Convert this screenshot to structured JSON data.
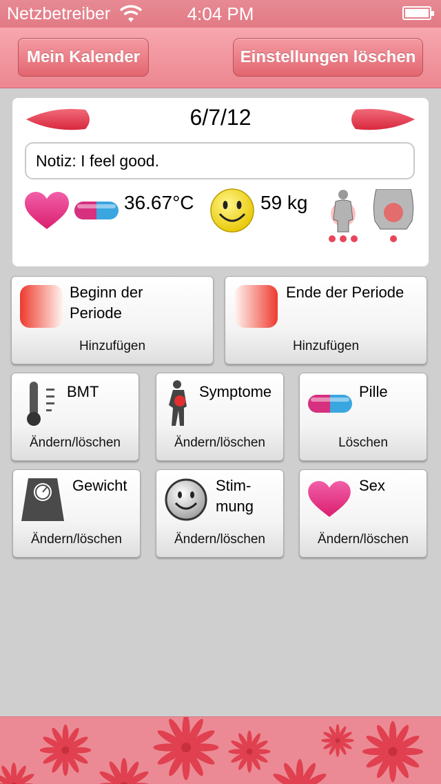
{
  "status_bar": {
    "carrier": "Netzbetreiber",
    "time": "4:04 PM"
  },
  "nav": {
    "back_label": "Mein Kalender",
    "clear_label": "Einstellungen löschen"
  },
  "day": {
    "date": "6/7/12",
    "note": "Notiz: I feel good.",
    "temperature": "36.67°C",
    "weight": "59 kg"
  },
  "tiles": {
    "period_start": {
      "title_line1": "Beginn der",
      "title_line2": "Periode",
      "action": "Hinzufügen"
    },
    "period_end": {
      "title": "Ende der Periode",
      "action": "Hinzufügen"
    },
    "bmt": {
      "title": "BMT",
      "action": "Ändern/löschen"
    },
    "symptoms": {
      "title": "Symptome",
      "action": "Ändern/löschen"
    },
    "pill": {
      "title": "Pille",
      "action": "Löschen"
    },
    "weight": {
      "title": "Gewicht",
      "action": "Ändern/löschen"
    },
    "mood": {
      "title_line1": "Stim-",
      "title_line2": "mung",
      "action": "Ändern/löschen"
    },
    "sex": {
      "title": "Sex",
      "action": "Ändern/löschen"
    }
  },
  "icons": [
    "wifi-icon",
    "battery-icon",
    "prev-day-arrow-icon",
    "next-day-arrow-icon",
    "heart-icon",
    "pill-icon",
    "smiley-icon",
    "body-symptom-icon",
    "abdomen-symptom-icon",
    "thermometer-icon",
    "scale-icon",
    "flower-pattern"
  ],
  "colors": {
    "accent": "#e27a85",
    "brand_red": "#e8455a",
    "pink": "#e93c8b",
    "blue": "#3aa6e0"
  }
}
